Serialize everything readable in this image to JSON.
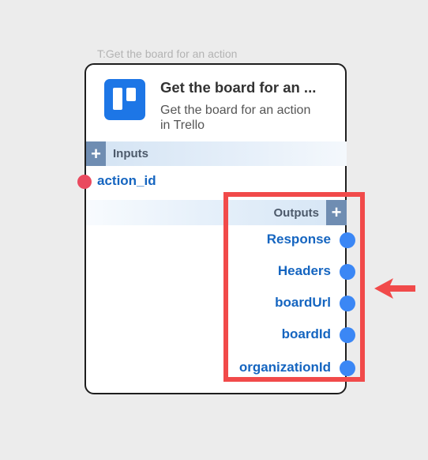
{
  "node_caption": "T:Get the board for an action",
  "node": {
    "app_icon": "trello-icon",
    "title": "Get the board for an ...",
    "subtitle": "Get the board for an action in Trello",
    "inputs_section": {
      "label": "Inputs",
      "add_icon": "+"
    },
    "inputs": [
      {
        "label": "action_id"
      }
    ],
    "outputs_section": {
      "label": "Outputs",
      "add_icon": "+"
    },
    "outputs": [
      {
        "label": "Response"
      },
      {
        "label": "Headers"
      },
      {
        "label": "boardUrl"
      },
      {
        "label": "boardId"
      },
      {
        "label": "organizationId"
      }
    ]
  },
  "annotation": {
    "highlight_color": "#f14a4a",
    "arrow_direction": "left"
  },
  "colors": {
    "input_port": "#ea4a5f",
    "output_port": "#3b87f5",
    "port_label": "#1565c0",
    "app_icon_bg": "#1d76e6"
  }
}
